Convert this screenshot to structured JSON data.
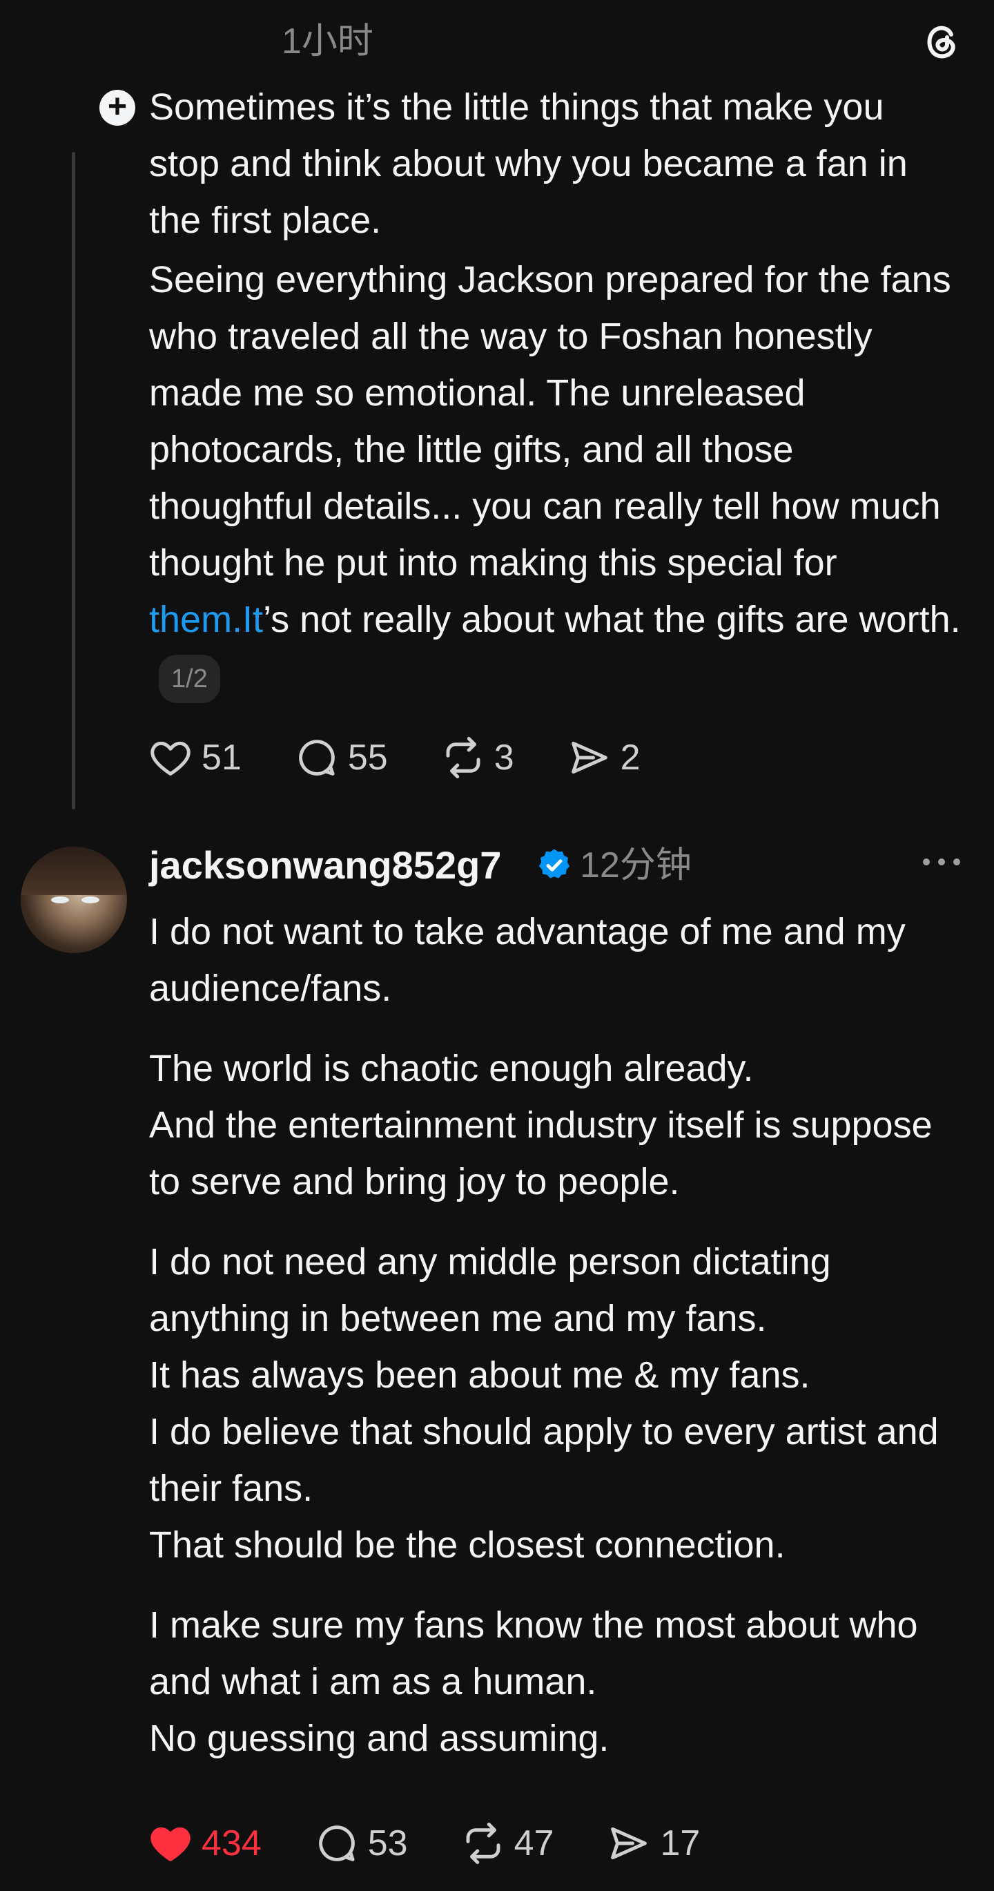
{
  "top": {
    "time": "1小时"
  },
  "post1": {
    "paragraphs": [
      "Sometimes it’s the little things that make you stop and think about why you became a fan in the first place.",
      "Seeing everything Jackson prepared for the fans who traveled all the way to Foshan honestly made me so emotional. The unreleased photocards, the little gifts, and all those thoughtful details... you can really tell how much thought he put into making this special for "
    ],
    "link_text": "them.It",
    "after_link": "’s not really about what the gifts are worth.",
    "page_badge": "1/2",
    "actions": {
      "likes": "51",
      "replies": "55",
      "reposts": "3",
      "shares": "2"
    }
  },
  "post2": {
    "username": "jacksonwang852g7",
    "time": "12分钟",
    "blocks": [
      [
        "I do not want to take advantage of me and my audience/fans."
      ],
      [
        "The world is chaotic enough already.",
        "And the entertainment industry itself is suppose to serve and bring joy to people."
      ],
      [
        "I do not need any middle person dictating anything in between me and my fans.",
        "It has always been about me & my fans.",
        "I do believe that should apply to every artist and their fans.",
        "That should be the closest connection."
      ],
      [
        "I make sure my fans know the most about who and what i am as a human.",
        "No guessing and assuming."
      ]
    ],
    "actions": {
      "likes": "434",
      "replies": "53",
      "reposts": "47",
      "shares": "17"
    },
    "liked": true
  },
  "colors": {
    "background": "#101010",
    "text": "#f3f5f7",
    "muted": "#8a8a8a",
    "link": "#1d9bf0",
    "like_active": "#ff3040",
    "verified": "#0095f6"
  },
  "icons": [
    "threads-logo-icon",
    "follow-plus-icon",
    "heart-icon",
    "reply-bubble-icon",
    "repost-icon",
    "share-send-icon",
    "verified-badge-icon",
    "more-icon"
  ]
}
